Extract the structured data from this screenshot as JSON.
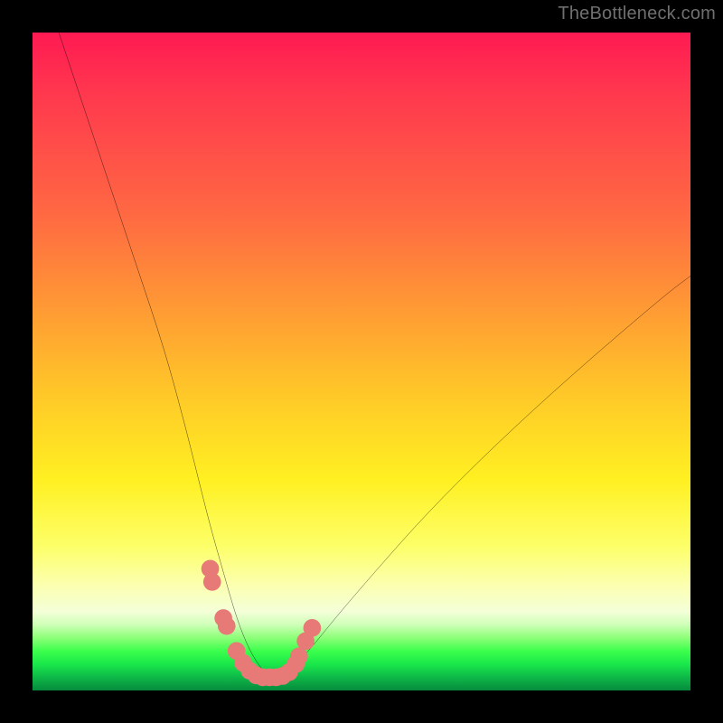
{
  "watermark": "TheBottleneck.com",
  "chart_data": {
    "type": "line",
    "title": "",
    "xlabel": "",
    "ylabel": "",
    "xlim": [
      0,
      100
    ],
    "ylim": [
      0,
      100
    ],
    "grid": false,
    "series": [
      {
        "name": "bottleneck-curve",
        "x": [
          4,
          8,
          12,
          16,
          20,
          23,
          25,
          27,
          29,
          31,
          33,
          35,
          36,
          37,
          39,
          42,
          46,
          52,
          60,
          70,
          82,
          96,
          100
        ],
        "values": [
          100,
          88,
          76,
          64,
          52,
          41,
          33,
          25,
          18,
          11,
          6,
          3,
          2,
          2,
          3,
          6,
          11,
          18,
          27,
          37,
          48,
          60,
          63
        ]
      }
    ],
    "markers": {
      "name": "gpu-points",
      "color": "#e77a76",
      "x": [
        27.0,
        27.3,
        29.0,
        29.5,
        31.0,
        32.0,
        33.0,
        34.0,
        35.0,
        36.0,
        37.0,
        38.0,
        39.0,
        40.0,
        40.5,
        41.5,
        42.5
      ],
      "values": [
        18.5,
        16.5,
        11.0,
        9.8,
        6.0,
        4.2,
        3.0,
        2.3,
        2.0,
        2.0,
        2.0,
        2.2,
        2.8,
        4.0,
        5.2,
        7.5,
        9.5
      ]
    },
    "gradient_stops": [
      {
        "pos": 0,
        "color": "#ff1a52"
      },
      {
        "pos": 28,
        "color": "#ff6a42"
      },
      {
        "pos": 55,
        "color": "#ffc828"
      },
      {
        "pos": 78,
        "color": "#fdff68"
      },
      {
        "pos": 92,
        "color": "#8cff78"
      },
      {
        "pos": 100,
        "color": "#068a3c"
      }
    ]
  }
}
